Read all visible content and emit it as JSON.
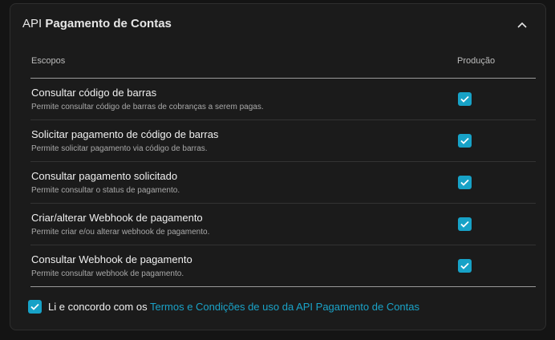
{
  "panel": {
    "title_prefix": "API",
    "title_bold": "Pagamento de Contas"
  },
  "table": {
    "col_scopes": "Escopos",
    "col_production": "Produção",
    "rows": [
      {
        "name": "Consultar código de barras",
        "desc": "Permite consultar código de barras de cobranças a serem pagas.",
        "checked": true
      },
      {
        "name": "Solicitar pagamento de código de barras",
        "desc": "Permite solicitar pagamento via código de barras.",
        "checked": true
      },
      {
        "name": "Consultar pagamento solicitado",
        "desc": "Permite consultar o status de pagamento.",
        "checked": true
      },
      {
        "name": "Criar/alterar Webhook de pagamento",
        "desc": "Permite criar e/ou alterar webhook de pagamento.",
        "checked": true
      },
      {
        "name": "Consultar Webhook de pagamento",
        "desc": "Permite consultar webhook de pagamento.",
        "checked": true
      }
    ]
  },
  "agreement": {
    "checked": true,
    "text": "Li e concordo com os",
    "link": "Termos e Condições de uso da API Pagamento de Contas"
  },
  "colors": {
    "accent": "#17a2c7",
    "panel_bg": "#1b1b1b",
    "page_bg": "#141414"
  },
  "icons": {
    "collapse": "chevron-up-icon",
    "check": "checkmark-icon"
  }
}
